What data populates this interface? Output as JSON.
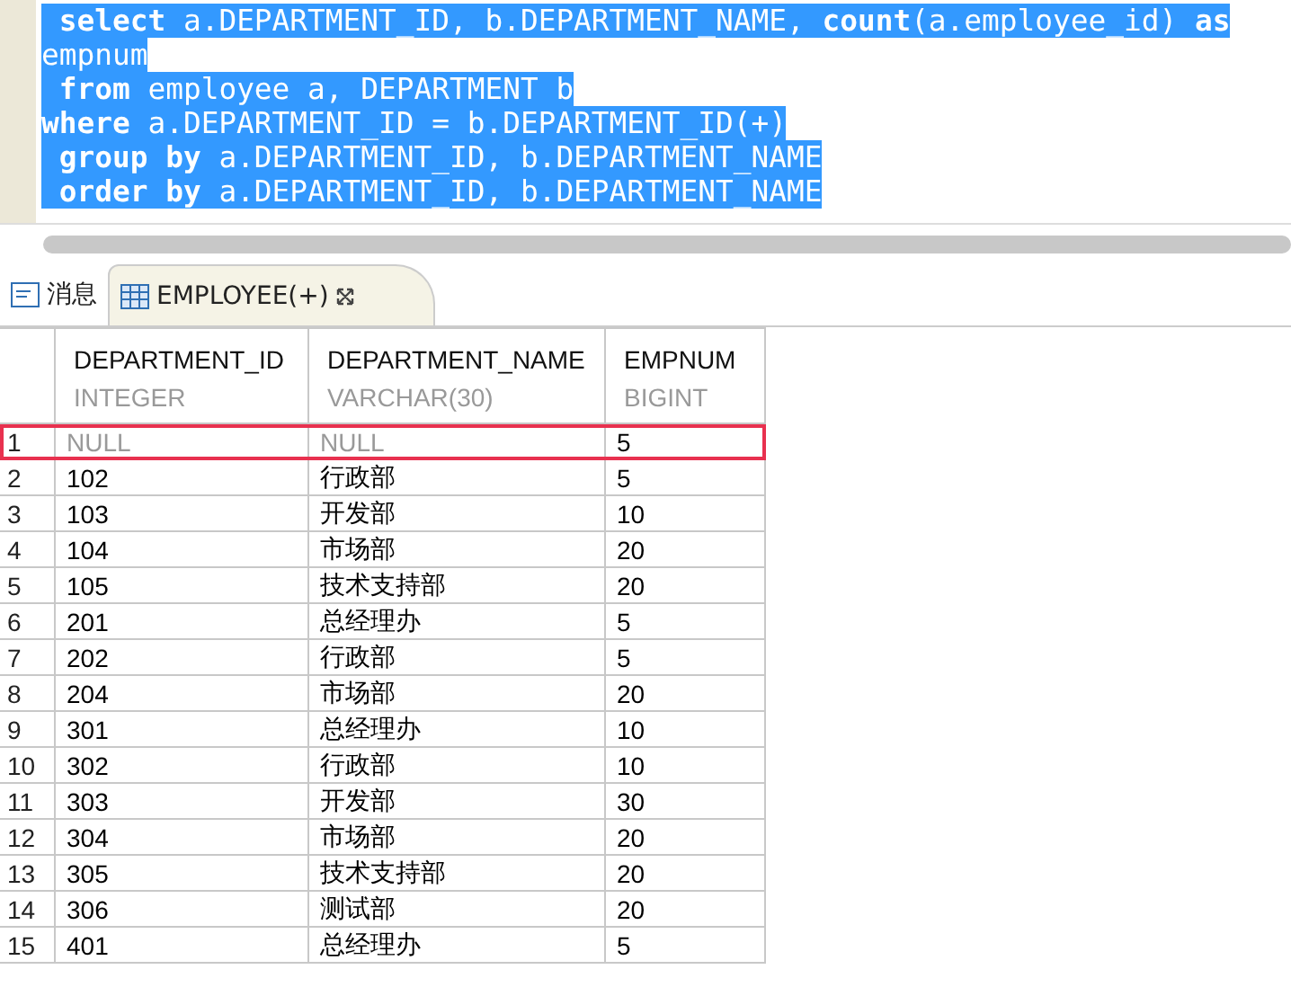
{
  "editor": {
    "lines": [
      {
        "text": " **select** a.DEPARTMENT_ID, b.DEPARTMENT_NAME, **count**(a.employee_id) **as**",
        "selected": true
      },
      {
        "text": "empnum",
        "selected": true
      },
      {
        "text": " **from** employee a, DEPARTMENT b",
        "selected": true
      },
      {
        "text": "**where** a.DEPARTMENT_ID = b.DEPARTMENT_ID(+)",
        "selected": true
      },
      {
        "text": " **group by** a.DEPARTMENT_ID, b.DEPARTMENT_NAME",
        "selected": true
      },
      {
        "text": " **order by** a.DEPARTMENT_ID, b.DEPARTMENT_NAME",
        "selected": true
      }
    ]
  },
  "tabs": [
    {
      "label": "消息",
      "kind": "messages",
      "selected": false,
      "closable": false
    },
    {
      "label": "EMPLOYEE(+)",
      "kind": "table",
      "selected": true,
      "closable": true
    }
  ],
  "table": {
    "columns": [
      {
        "name": "DEPARTMENT_ID",
        "type": "INTEGER"
      },
      {
        "name": "DEPARTMENT_NAME",
        "type": "VARCHAR(30)"
      },
      {
        "name": "EMPNUM",
        "type": "BIGINT"
      }
    ],
    "rows": [
      {
        "num": "1",
        "highlighted": true,
        "cells": [
          {
            "text": "NULL",
            "null": true
          },
          {
            "text": "NULL",
            "null": true
          },
          {
            "text": "5",
            "null": false
          }
        ]
      },
      {
        "num": "2",
        "highlighted": false,
        "cells": [
          {
            "text": "102",
            "null": false
          },
          {
            "text": "行政部",
            "null": false
          },
          {
            "text": "5",
            "null": false
          }
        ]
      },
      {
        "num": "3",
        "highlighted": false,
        "cells": [
          {
            "text": "103",
            "null": false
          },
          {
            "text": "开发部",
            "null": false
          },
          {
            "text": "10",
            "null": false
          }
        ]
      },
      {
        "num": "4",
        "highlighted": false,
        "cells": [
          {
            "text": "104",
            "null": false
          },
          {
            "text": "市场部",
            "null": false
          },
          {
            "text": "20",
            "null": false
          }
        ]
      },
      {
        "num": "5",
        "highlighted": false,
        "cells": [
          {
            "text": "105",
            "null": false
          },
          {
            "text": "技术支持部",
            "null": false
          },
          {
            "text": "20",
            "null": false
          }
        ]
      },
      {
        "num": "6",
        "highlighted": false,
        "cells": [
          {
            "text": "201",
            "null": false
          },
          {
            "text": "总经理办",
            "null": false
          },
          {
            "text": "5",
            "null": false
          }
        ]
      },
      {
        "num": "7",
        "highlighted": false,
        "cells": [
          {
            "text": "202",
            "null": false
          },
          {
            "text": "行政部",
            "null": false
          },
          {
            "text": "5",
            "null": false
          }
        ]
      },
      {
        "num": "8",
        "highlighted": false,
        "cells": [
          {
            "text": "204",
            "null": false
          },
          {
            "text": "市场部",
            "null": false
          },
          {
            "text": "20",
            "null": false
          }
        ]
      },
      {
        "num": "9",
        "highlighted": false,
        "cells": [
          {
            "text": "301",
            "null": false
          },
          {
            "text": "总经理办",
            "null": false
          },
          {
            "text": "10",
            "null": false
          }
        ]
      },
      {
        "num": "10",
        "highlighted": false,
        "cells": [
          {
            "text": "302",
            "null": false
          },
          {
            "text": "行政部",
            "null": false
          },
          {
            "text": "10",
            "null": false
          }
        ]
      },
      {
        "num": "11",
        "highlighted": false,
        "cells": [
          {
            "text": "303",
            "null": false
          },
          {
            "text": "开发部",
            "null": false
          },
          {
            "text": "30",
            "null": false
          }
        ]
      },
      {
        "num": "12",
        "highlighted": false,
        "cells": [
          {
            "text": "304",
            "null": false
          },
          {
            "text": "市场部",
            "null": false
          },
          {
            "text": "20",
            "null": false
          }
        ]
      },
      {
        "num": "13",
        "highlighted": false,
        "cells": [
          {
            "text": "305",
            "null": false
          },
          {
            "text": "技术支持部",
            "null": false
          },
          {
            "text": "20",
            "null": false
          }
        ]
      },
      {
        "num": "14",
        "highlighted": false,
        "cells": [
          {
            "text": "306",
            "null": false
          },
          {
            "text": "测试部",
            "null": false
          },
          {
            "text": "20",
            "null": false
          }
        ]
      },
      {
        "num": "15",
        "highlighted": false,
        "cells": [
          {
            "text": "401",
            "null": false
          },
          {
            "text": "总经理办",
            "null": false
          },
          {
            "text": "5",
            "null": false
          }
        ]
      }
    ]
  }
}
